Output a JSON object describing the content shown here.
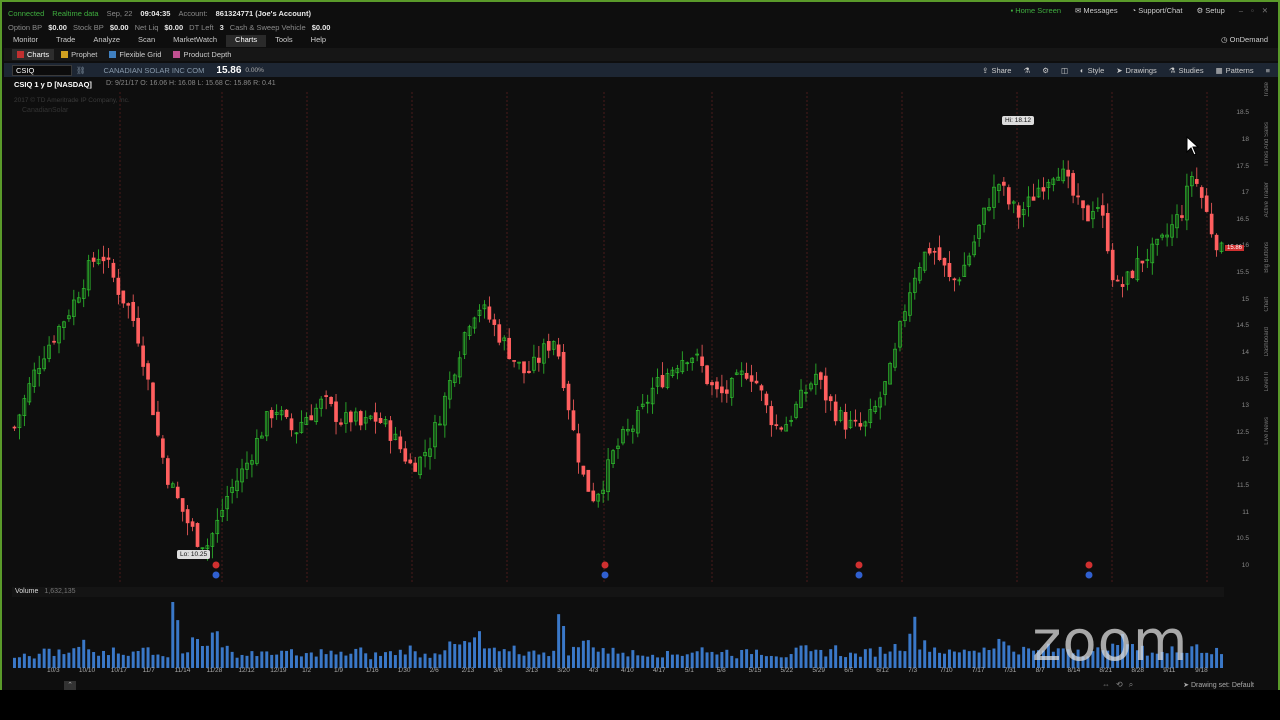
{
  "status": {
    "connected": "Connected",
    "realtime": "Realtime data",
    "date": "Sep, 22",
    "time": "09:04:35",
    "account_label": "Account:",
    "account_value": "861324771 (Joe's Account)"
  },
  "top_right": {
    "home_screen": "Home Screen",
    "messages": "Messages",
    "support": "Support/Chat",
    "setup": "Setup"
  },
  "balances": [
    {
      "label": "Option BP",
      "value": "$0.00"
    },
    {
      "label": "Stock BP",
      "value": "$0.00"
    },
    {
      "label": "Net Liq",
      "value": "$0.00"
    },
    {
      "label": "DT Left",
      "value": "3"
    },
    {
      "label": "Cash & Sweep Vehicle",
      "value": "$0.00"
    }
  ],
  "nav": [
    "Monitor",
    "Trade",
    "Analyze",
    "Scan",
    "MarketWatch",
    "Charts",
    "Tools",
    "Help"
  ],
  "ondemand": "OnDemand",
  "subtabs": [
    "Charts",
    "Prophet",
    "Flexible Grid",
    "Product Depth"
  ],
  "toolbar": {
    "symbol": "CSIQ",
    "company": "CANADIAN SOLAR INC COM",
    "last": "15.86",
    "pct": "0.00%",
    "share": "Share",
    "style": "Style",
    "drawings": "Drawings",
    "studies": "Studies",
    "patterns": "Patterns"
  },
  "chart_header": {
    "title": "CSIQ 1 y D [NASDAQ]",
    "ohlc": "D: 9/21/17   O: 16.06   H: 16.08   L: 15.68   C: 15.86   R: 0.41",
    "watermark1": "2017 © TD Ameritrade IP Company, Inc.",
    "watermark2": "CanadianSolar"
  },
  "hi_label": "Hi: 18.12",
  "lo_label": "Lo: 10.25",
  "price_tag": "15.86",
  "volume": {
    "label": "Volume",
    "value": "1,632,135"
  },
  "drawing_set": "Drawing set: Default",
  "zoom_logo": "zoom",
  "side_tabs": [
    "Trade",
    "Times And Sales",
    "Active Trader",
    "Big Buttons",
    "Chart",
    "Dashboard",
    "Level II",
    "Live News"
  ],
  "chart_data": {
    "type": "candlestick",
    "symbol": "CSIQ",
    "ylim": [
      9.7,
      18.9
    ],
    "y_ticks": [
      18.5,
      18,
      17.5,
      17,
      16.5,
      16,
      15.5,
      15,
      14.5,
      14,
      13.5,
      13,
      12.5,
      12,
      11.5,
      11,
      10.5,
      10
    ],
    "x_ticks": [
      "10/3",
      "10/10",
      "10/17",
      "11/7",
      "11/14",
      "11/28",
      "12/12",
      "12/19",
      "1/2",
      "1/9",
      "1/16",
      "1/30",
      "2/6",
      "2/13",
      "3/6",
      "3/13",
      "3/20",
      "4/3",
      "4/10",
      "4/17",
      "5/1",
      "5/8",
      "5/15",
      "5/22",
      "5/29",
      "6/5",
      "6/12",
      "7/3",
      "7/10",
      "7/17",
      "7/31",
      "8/7",
      "8/14",
      "8/21",
      "8/28",
      "9/11",
      "9/18"
    ],
    "close_path": [
      12.6,
      13.1,
      13.6,
      14.0,
      14.3,
      14.6,
      14.9,
      15.3,
      15.7,
      15.9,
      15.5,
      15.1,
      14.8,
      14.2,
      13.3,
      12.3,
      11.6,
      11.2,
      10.8,
      10.5,
      10.4,
      10.8,
      11.3,
      11.6,
      11.9,
      12.3,
      12.7,
      13.0,
      12.7,
      12.5,
      12.8,
      12.9,
      13.1,
      12.9,
      12.7,
      12.8,
      12.6,
      12.8,
      12.7,
      12.5,
      12.2,
      11.9,
      12.0,
      12.3,
      12.8,
      13.4,
      14.0,
      14.6,
      14.9,
      14.7,
      14.4,
      14.1,
      13.8,
      13.6,
      13.8,
      14.1,
      14.3,
      13.4,
      12.4,
      11.6,
      11.3,
      11.6,
      12.1,
      12.4,
      12.6,
      12.9,
      13.3,
      13.5,
      13.7,
      13.9,
      14.0,
      13.8,
      13.4,
      13.2,
      13.3,
      13.5,
      13.7,
      13.4,
      12.9,
      12.6,
      12.7,
      13.0,
      13.3,
      13.6,
      13.2,
      12.9,
      12.7,
      12.6,
      12.6,
      12.9,
      13.3,
      13.8,
      14.7,
      15.4,
      15.8,
      16.0,
      15.7,
      15.3,
      15.5,
      15.9,
      16.4,
      16.9,
      17.2,
      16.8,
      16.6,
      16.8,
      17.1,
      17.3,
      17.5,
      17.2,
      16.8,
      16.5,
      16.9,
      16.3,
      15.2,
      15.3,
      15.6,
      15.8,
      15.9,
      16.1,
      16.4,
      16.7,
      17.4,
      16.9,
      16.3,
      15.9
    ],
    "volume": [
      0.9,
      1.1,
      0.8,
      1.3,
      1.0,
      0.9,
      1.2,
      1.5,
      1.0,
      0.9,
      1.1,
      0.8,
      1.0,
      1.4,
      1.2,
      1.0,
      4.2,
      1.3,
      1.8,
      1.5,
      3.1,
      1.2,
      1.0,
      0.9,
      1.1,
      1.0,
      0.9,
      1.2,
      1.0,
      0.8,
      0.9,
      1.1,
      1.0,
      0.9,
      1.0,
      1.2,
      0.8,
      0.9,
      1.0,
      1.1,
      1.3,
      1.0,
      0.9,
      1.2,
      1.4,
      1.5,
      1.6,
      2.0,
      1.3,
      1.1,
      1.0,
      1.4,
      1.1,
      1.0,
      1.2,
      1.1,
      3.0,
      1.2,
      1.6,
      1.8,
      1.3,
      1.1,
      1.2,
      1.0,
      0.9,
      1.1,
      1.0,
      0.9,
      1.0,
      1.1,
      1.3,
      1.0,
      1.2,
      1.1,
      0.9,
      1.0,
      1.2,
      1.1,
      1.0,
      0.9,
      1.1,
      1.2,
      1.0,
      1.1,
      1.3,
      1.0,
      0.9,
      1.0,
      1.1,
      1.2,
      1.4,
      1.6,
      2.8,
      1.8,
      1.4,
      1.2,
      1.0,
      1.1,
      1.3,
      1.2,
      1.4,
      1.8,
      1.6,
      1.3,
      1.2,
      1.1,
      1.3,
      1.2,
      1.4,
      1.3,
      1.1,
      1.2,
      1.0,
      2.2,
      1.8,
      1.3,
      1.2,
      1.1,
      1.0,
      1.2,
      1.4,
      1.6,
      1.2,
      1.1,
      1.0
    ]
  }
}
